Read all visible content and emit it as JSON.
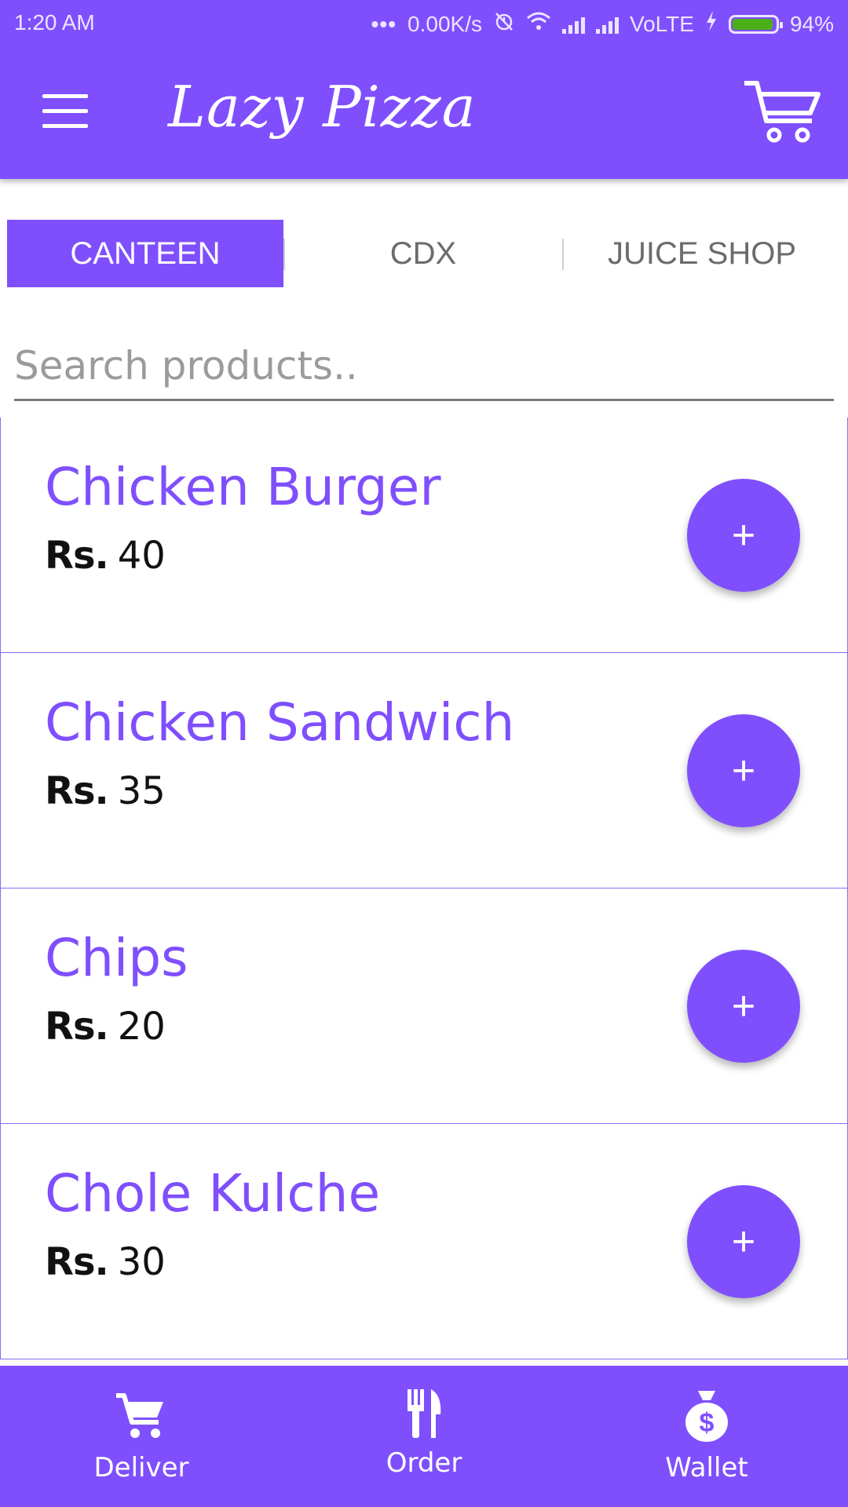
{
  "status_bar": {
    "time": "1:20 AM",
    "speed": "0.00K/s",
    "network": "VoLTE",
    "battery_pct": "94%",
    "battery_level": 0.94,
    "battery_color": "#4caf17"
  },
  "app_bar": {
    "title": "Lazy Pizza",
    "menu_icon": "hamburger-menu-icon",
    "cart_icon": "cart-icon",
    "color": "#7f4ffd"
  },
  "tabs": [
    {
      "label": "CANTEEN",
      "active": true
    },
    {
      "label": "CDX",
      "active": false
    },
    {
      "label": "JUICE SHOP",
      "active": false
    }
  ],
  "search": {
    "placeholder": "Search products.."
  },
  "products": [
    {
      "name": "Chicken Burger",
      "currency": "Rs.",
      "price": "40",
      "add_label": "+"
    },
    {
      "name": "Chicken Sandwich",
      "currency": "Rs.",
      "price": "35",
      "add_label": "+"
    },
    {
      "name": "Chips",
      "currency": "Rs.",
      "price": "20",
      "add_label": "+"
    },
    {
      "name": "Chole Kulche",
      "currency": "Rs.",
      "price": "30",
      "add_label": "+"
    }
  ],
  "bottom_nav": [
    {
      "label": "Deliver",
      "icon": "shopping-cart-icon"
    },
    {
      "label": "Order",
      "icon": "fork-knife-icon"
    },
    {
      "label": "Wallet",
      "icon": "money-bag-icon"
    }
  ]
}
